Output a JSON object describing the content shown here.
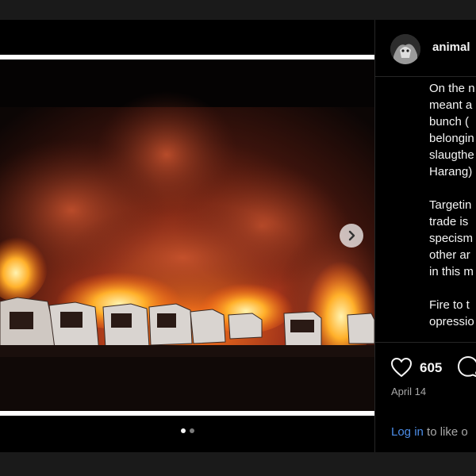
{
  "post": {
    "username": "animal",
    "caption_lines": [
      "On the n",
      "meant a",
      "bunch (",
      "belongin",
      "slaugthe",
      "Harang)",
      "",
      "Targetin",
      "trade is",
      "specism",
      "other ar",
      "in this m",
      "",
      "Fire to t",
      "opressio"
    ],
    "likes": "605",
    "date": "April 14"
  },
  "carousel": {
    "slide_count": 2,
    "active_index": 0
  },
  "footer": {
    "login_link": "Log in",
    "login_rest": " to like o"
  },
  "icons": {
    "next": "chevron-right-icon",
    "like": "heart-icon",
    "comment": "comment-icon"
  },
  "colors": {
    "link": "#4c8de8",
    "muted": "#a8a8a8",
    "background": "#000000"
  }
}
